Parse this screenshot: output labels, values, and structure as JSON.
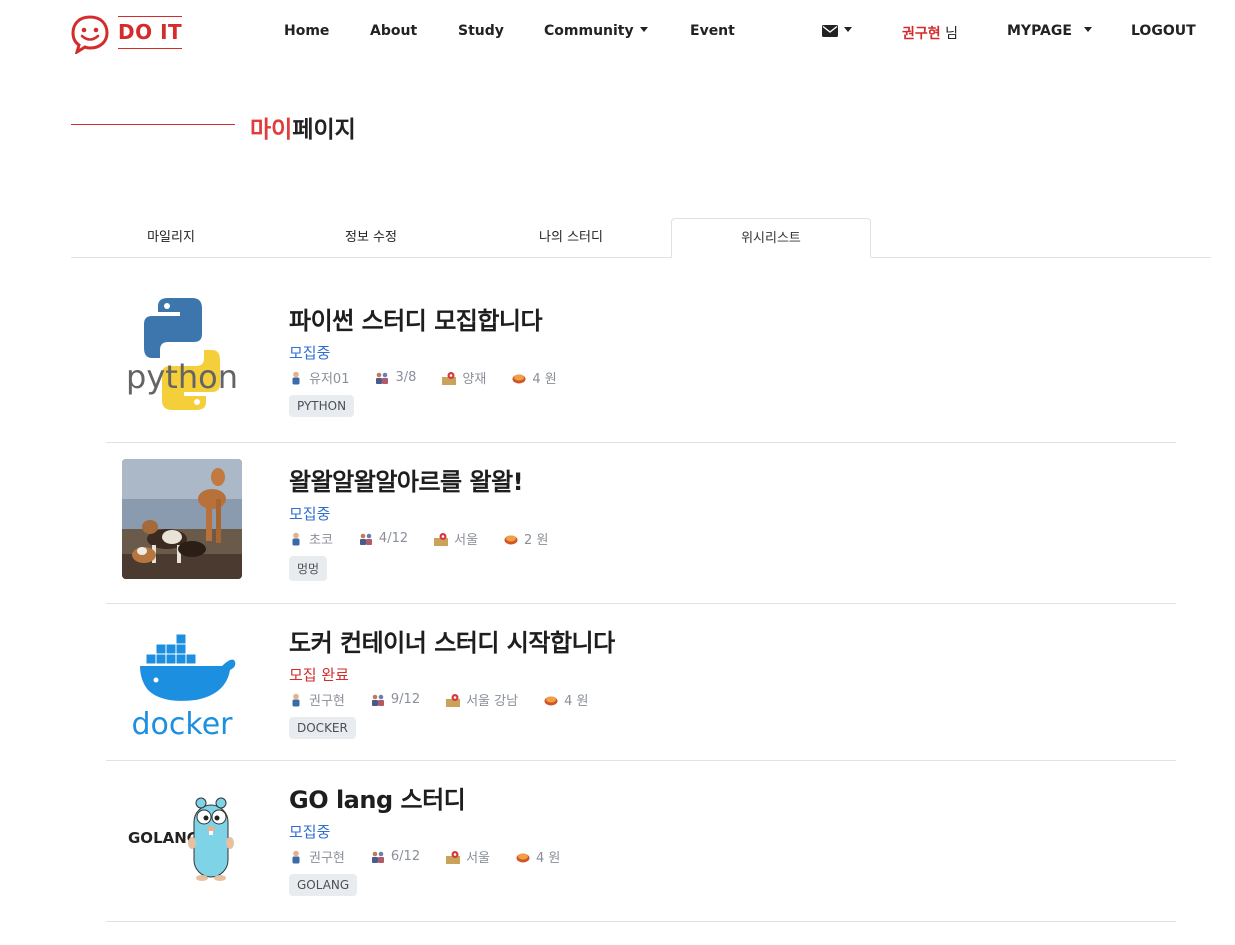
{
  "nav": {
    "logo_text": "DO IT",
    "links": [
      "Home",
      "About",
      "Study",
      "Community",
      "Event"
    ],
    "user_name": "권구현",
    "user_suffix": "님",
    "mypage": "MYPAGE",
    "logout": "LOGOUT"
  },
  "page_title": {
    "highlight": "마이",
    "rest": "페이지"
  },
  "tabs": [
    "마일리지",
    "정보 수정",
    "나의 스터디",
    "위시리스트"
  ],
  "active_tab": "위시리스트",
  "colors": {
    "brand_red": "#d42b2b",
    "status_open": "#2f6fd0",
    "status_closed": "#d42b2b"
  },
  "studies": [
    {
      "image": "python-logo",
      "title": "파이썬 스터디 모집합니다",
      "status": "모집중",
      "leader": "유저01",
      "members": "3/8",
      "location": "양재",
      "cost": "4 원",
      "tag": "PYTHON"
    },
    {
      "image": "dogs-photo",
      "title": "왈왈알왈알아르를 왈왈!",
      "status": "모집중",
      "leader": "초코",
      "members": "4/12",
      "location": "서울",
      "cost": "2 원",
      "tag": "멍멍"
    },
    {
      "image": "docker-logo",
      "title": "도커 컨테이너 스터디 시작합니다",
      "status": "모집 완료",
      "leader": "권구현",
      "members": "9/12",
      "location": "서울 강남",
      "cost": "4 원",
      "tag": "DOCKER"
    },
    {
      "image": "golang-logo",
      "title": "GO lang 스터디",
      "status": "모집중",
      "leader": "권구현",
      "members": "6/12",
      "location": "서울",
      "cost": "4 원",
      "tag": "GOLANG",
      "logo_text": "GOLANG"
    }
  ]
}
